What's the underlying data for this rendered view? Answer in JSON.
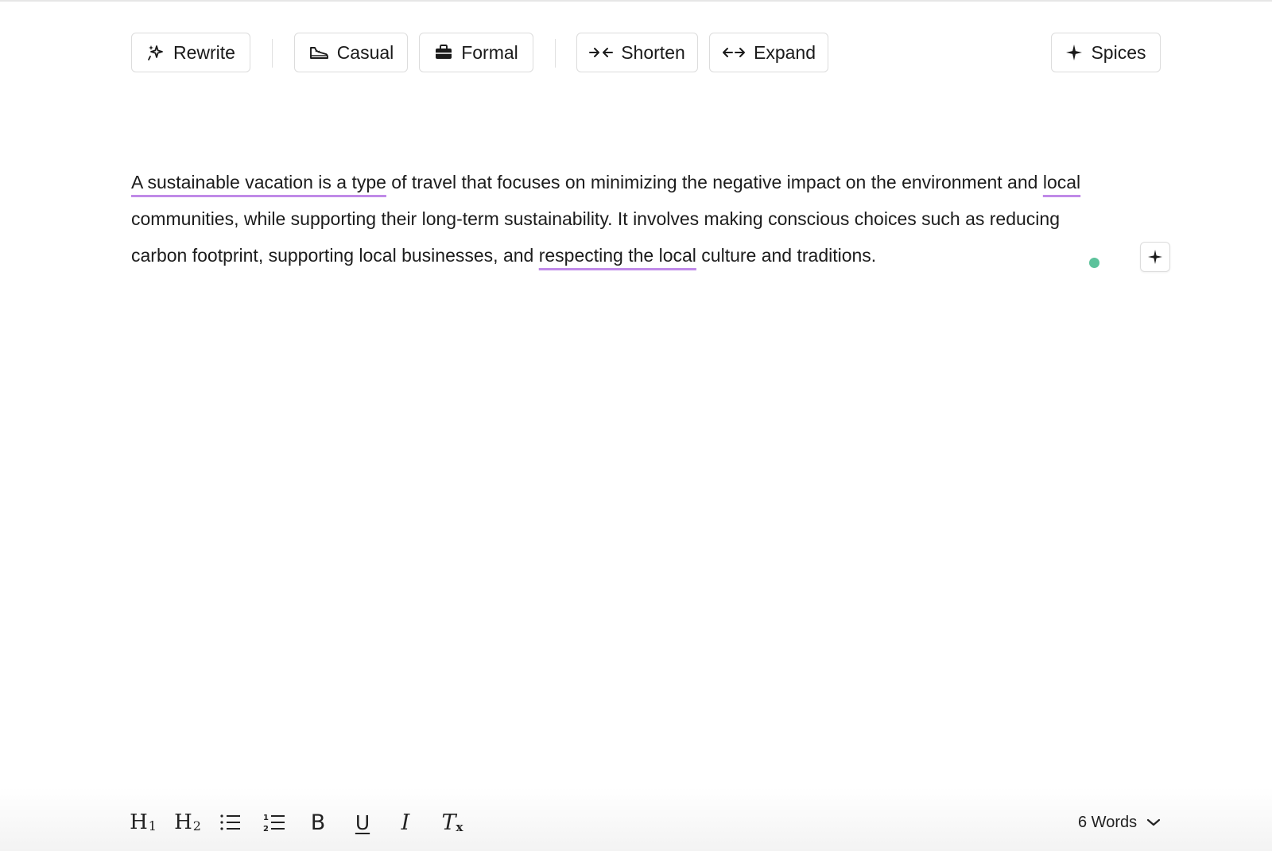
{
  "toolbar": {
    "rewrite": "Rewrite",
    "casual": "Casual",
    "formal": "Formal",
    "shorten": "Shorten",
    "expand": "Expand",
    "spices": "Spices"
  },
  "content": {
    "segments": [
      {
        "text": "A sustainable vacation is a type",
        "highlight": true
      },
      {
        "text": " of travel that focuses on minimizing the negative impact on the environment and ",
        "highlight": false
      },
      {
        "text": "local",
        "highlight": true
      },
      {
        "text": " communities, while supporting their long-term sustainability. It involves making conscious choices such as reducing carbon footprint, supporting local businesses, and ",
        "highlight": false
      },
      {
        "text": "respecting the local",
        "highlight": true
      },
      {
        "text": " culture and traditions.",
        "highlight": false
      }
    ],
    "highlight_color": "#c08ae8",
    "status_dot_color": "#5cc29b"
  },
  "format_bar": {
    "h1": "H",
    "h1_sub": "1",
    "h2": "H",
    "h2_sub": "2",
    "bold": "B",
    "underline": "U",
    "italic": "I",
    "clear": "T",
    "clear_sub": "x"
  },
  "word_count": "6 Words",
  "icons": [
    "sparkle-icon",
    "shoe-icon",
    "briefcase-icon",
    "shorten-arrows-icon",
    "expand-arrows-icon",
    "plus-icon",
    "bullet-list-icon",
    "numbered-list-icon",
    "chevron-down-icon"
  ]
}
